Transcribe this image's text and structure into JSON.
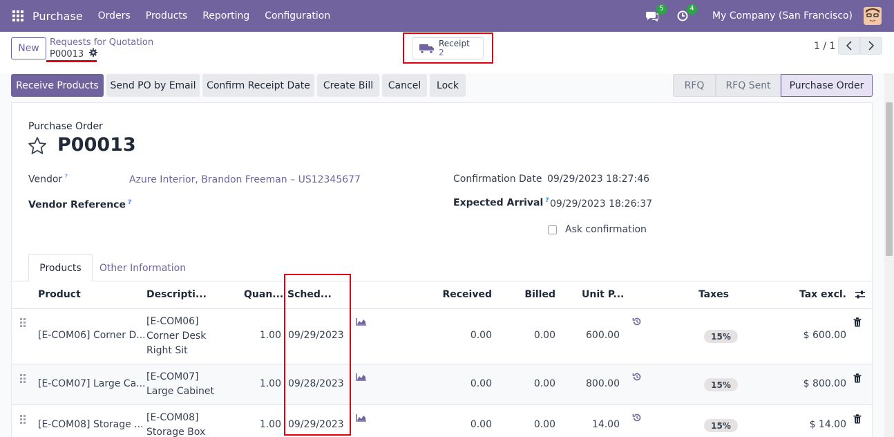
{
  "navbar": {
    "app_name": "Purchase",
    "menu": [
      "Orders",
      "Products",
      "Reporting",
      "Configuration"
    ],
    "messages_count": "5",
    "activities_count": "4",
    "company": "My Company (San Francisco)"
  },
  "control_panel": {
    "new_label": "New",
    "breadcrumb_parent": "Requests for Quotation",
    "breadcrumb_current": "P00013",
    "receipt_label": "Receipt",
    "receipt_count": "2",
    "pager": "1 / 1"
  },
  "actions": {
    "receive_products": "Receive Products",
    "send_po_email": "Send PO by Email",
    "confirm_receipt_date": "Confirm Receipt Date",
    "create_bill": "Create Bill",
    "cancel": "Cancel",
    "lock": "Lock"
  },
  "status_stages": [
    "RFQ",
    "RFQ Sent",
    "Purchase Order"
  ],
  "form": {
    "doc_type": "Purchase Order",
    "name": "P00013",
    "vendor_label": "Vendor",
    "vendor_value": "Azure Interior, Brandon Freeman – US12345677",
    "vendor_ref_label": "Vendor Reference",
    "confirmation_date_label": "Confirmation Date",
    "confirmation_date_value": "09/29/2023 18:27:46",
    "expected_arrival_label": "Expected Arrival",
    "expected_arrival_value": "09/29/2023 18:26:37",
    "ask_confirmation_label": "Ask confirmation",
    "help_mark": "?"
  },
  "tabs": [
    "Products",
    "Other Information"
  ],
  "table": {
    "headers": {
      "product": "Product",
      "description": "Descripti...",
      "quantity": "Quan...",
      "scheduled": "Sched...",
      "received": "Received",
      "billed": "Billed",
      "unit_price": "Unit P...",
      "taxes": "Taxes",
      "tax_excl": "Tax excl."
    },
    "rows": [
      {
        "product": "[E-COM06] Corner D...",
        "description": [
          "[E-COM06]",
          "Corner Desk",
          "Right Sit"
        ],
        "quantity": "1.00",
        "scheduled": "09/29/2023",
        "received": "0.00",
        "billed": "0.00",
        "unit_price": "600.00",
        "taxes": "15%",
        "tax_excl": "$ 600.00"
      },
      {
        "product": "[E-COM07] Large Ca...",
        "description": [
          "[E-COM07]",
          "Large Cabinet"
        ],
        "quantity": "1.00",
        "scheduled": "09/28/2023",
        "received": "0.00",
        "billed": "0.00",
        "unit_price": "800.00",
        "taxes": "15%",
        "tax_excl": "$ 800.00"
      },
      {
        "product": "[E-COM08] Storage ...",
        "description": [
          "[E-COM08]",
          "Storage Box"
        ],
        "quantity": "1.00",
        "scheduled": "09/29/2023",
        "received": "0.00",
        "billed": "0.00",
        "unit_price": "14.00",
        "taxes": "15%",
        "tax_excl": "$ 14.00"
      }
    ]
  },
  "colors": {
    "brand": "#71639e",
    "highlight": "#e3000f",
    "badge": "#28a745"
  },
  "icons": [
    "apps-grid-icon",
    "chat-icon",
    "clock-icon",
    "avatar",
    "gear-icon",
    "truck-icon",
    "chevron-left-icon",
    "chevron-right-icon",
    "star-icon",
    "drag-handle-icon",
    "chart-icon",
    "history-icon",
    "trash-icon",
    "column-settings-icon"
  ]
}
